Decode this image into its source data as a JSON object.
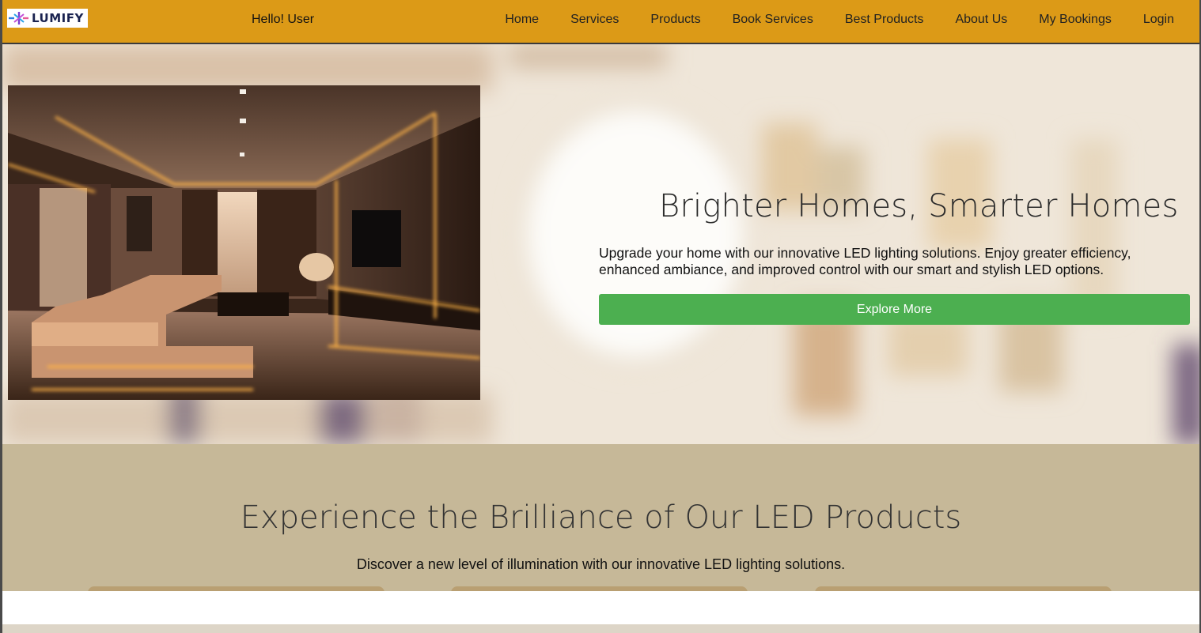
{
  "navbar": {
    "logo_text": "LUMIFY",
    "greeting": "Hello! User",
    "links": [
      "Home",
      "Services",
      "Products",
      "Book Services",
      "Best Products",
      "About Us",
      "My Bookings",
      "Login"
    ],
    "background_color": "#dc9a17"
  },
  "hero": {
    "title": "Brighter Homes, Smarter Homes",
    "description": "Upgrade your home with our innovative LED lighting solutions. Enjoy greater efficiency, enhanced ambiance, and improved control with our smart and stylish LED options.",
    "button_label": "Explore More",
    "button_color": "#4caf50"
  },
  "products": {
    "title": "Experience the Brilliance of Our LED Products",
    "subtitle": "Discover a new level of illumination with our innovative LED lighting solutions.",
    "background_color": "#c6b898"
  }
}
